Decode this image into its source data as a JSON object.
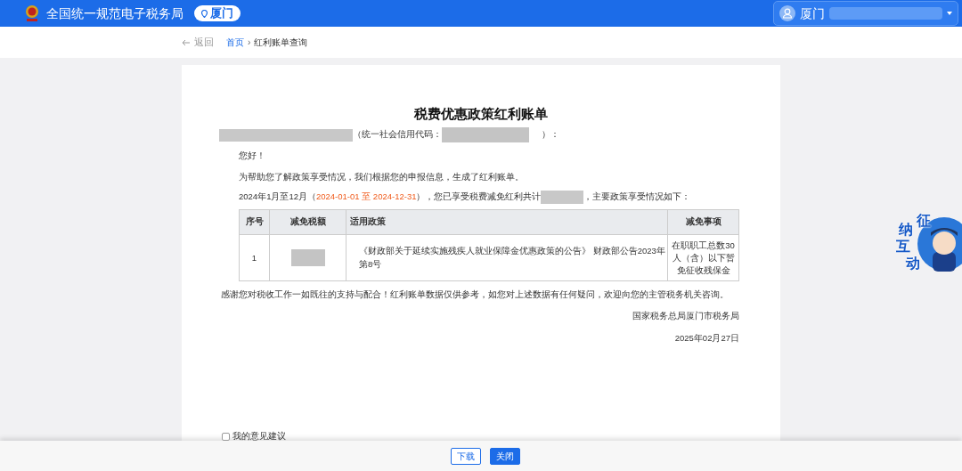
{
  "header": {
    "title": "全国统一规范电子税务局",
    "city": "厦门",
    "user": "厦门"
  },
  "nav": {
    "back": "返回",
    "breadcrumb": [
      "首页",
      "红利账单查询"
    ],
    "separator": "›"
  },
  "bill": {
    "title": "税费优惠政策红利账单",
    "credit_code_label": "（统一社会信用代码：",
    "credit_code_end": "）：",
    "greeting": "您好！",
    "intro": "为帮助您了解政策享受情况，我们根据您的申报信息，生成了红利账单。",
    "summary_prefix": "2024年1月至12月（",
    "summary_period": "2024-01-01 至 2024-12-31",
    "summary_middle": "），您已享受税费减免红利共计",
    "summary_suffix": "，主要政策享受情况如下：",
    "table": {
      "columns": [
        "序号",
        "减免税额",
        "适用政策",
        "减免事项"
      ],
      "rows": [
        {
          "cells": [
            "1",
            "",
            "《财政部关于延续实施残疾人就业保障金优惠政策的公告》 财政部公告2023年第8号",
            "在职职工总数30人（含）以下暂免征收残保金"
          ]
        }
      ]
    },
    "thanks": "感谢您对税收工作一如既往的支持与配合！红利账单数据仅供参考，如您对上述数据有任何疑问，欢迎向您的主管税务机关咨询。",
    "issuer": "国家税务总局厦门市税务局",
    "date": "2025年02月27日"
  },
  "feedback": {
    "label": "我的意见建议",
    "checked": false
  },
  "buttons": [
    {
      "label": "下载",
      "kind": "outline"
    },
    {
      "label": "关闭",
      "kind": "primary"
    }
  ],
  "assistant": {
    "label": [
      "征",
      "纳",
      "互",
      "动"
    ]
  }
}
